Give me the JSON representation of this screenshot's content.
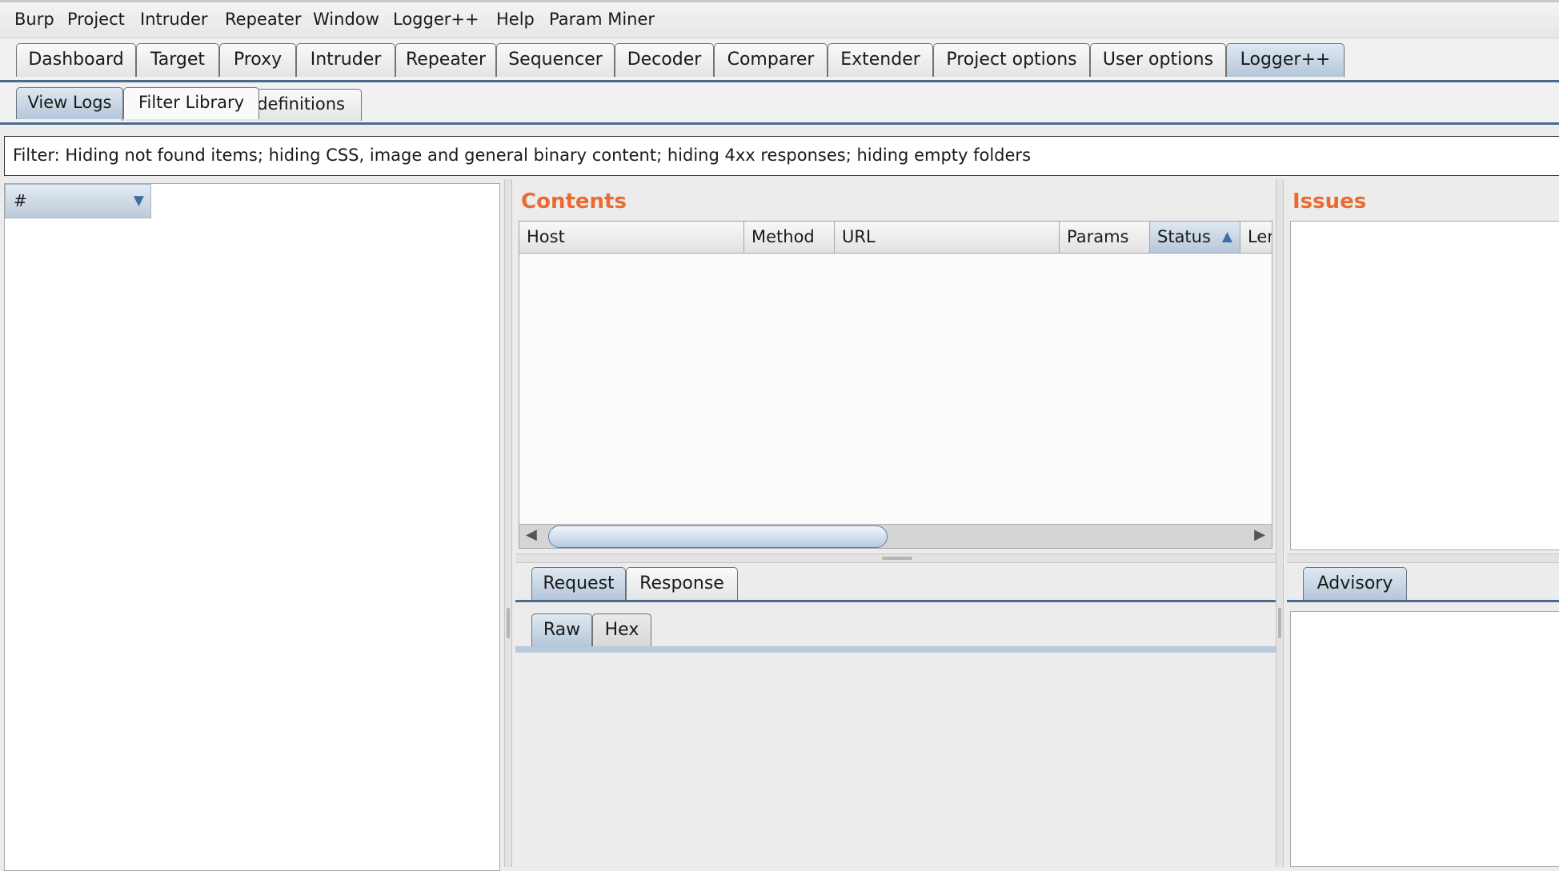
{
  "menu": [
    "Burp",
    "Project",
    "Intruder",
    "Repeater",
    "Window",
    "Logger++",
    "Help",
    "Param Miner"
  ],
  "main_tabs": [
    "Dashboard",
    "Target",
    "Proxy",
    "Intruder",
    "Repeater",
    "Sequencer",
    "Decoder",
    "Comparer",
    "Extender",
    "Project options",
    "User options",
    "Logger++"
  ],
  "main_tabs_selected": "Logger++",
  "sub_tabs": {
    "view_logs": "View Logs",
    "filter_library": "Filter Library",
    "definitions": "definitions"
  },
  "filter_text": "Filter: Hiding not found items;  hiding CSS, image and general binary content;  hiding 4xx responses;  hiding empty folders",
  "tree": {
    "column": "#"
  },
  "contents": {
    "title": "Contents",
    "columns": [
      "Host",
      "Method",
      "URL",
      "Params",
      "Status",
      "Ler"
    ],
    "sorted_column": "Status"
  },
  "issues": {
    "title": "Issues"
  },
  "message_tabs": [
    "Request",
    "Response"
  ],
  "view_tabs": [
    "Raw",
    "Hex"
  ],
  "advisory_tab": "Advisory",
  "colors": {
    "heading": "#ec6a32",
    "selected_tab": "#b4c6da",
    "tab_rule": "#4a6a8d"
  }
}
